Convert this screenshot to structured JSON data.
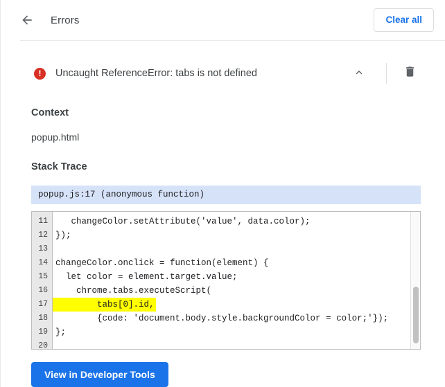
{
  "header": {
    "back_icon": "arrow-left-icon",
    "title": "Errors",
    "clear_all_label": "Clear all"
  },
  "error": {
    "icon": "error-circle-icon",
    "icon_glyph": "!",
    "title": "Uncaught ReferenceError: tabs is not defined",
    "collapse_icon": "chevron-up-icon",
    "delete_icon": "trash-icon"
  },
  "detail": {
    "context_label": "Context",
    "context_value": "popup.html",
    "stack_trace_label": "Stack Trace",
    "stack_entry": "popup.js:17 (anonymous function)"
  },
  "code": {
    "lines": [
      {
        "number": "11",
        "text": "   changeColor.setAttribute('value', data.color);",
        "highlight": false
      },
      {
        "number": "12",
        "text": "});",
        "highlight": false
      },
      {
        "number": "13",
        "text": "",
        "highlight": false
      },
      {
        "number": "14",
        "text": "changeColor.onclick = function(element) {",
        "highlight": false
      },
      {
        "number": "15",
        "text": "  let color = element.target.value;",
        "highlight": false
      },
      {
        "number": "16",
        "text": "    chrome.tabs.executeScript(",
        "highlight": false
      },
      {
        "number": "17",
        "text": "        tabs[0].id,",
        "highlight": true
      },
      {
        "number": "18",
        "text": "        {code: 'document.body.style.backgroundColor = color;'});",
        "highlight": false
      },
      {
        "number": "19",
        "text": "};",
        "highlight": false
      },
      {
        "number": "20",
        "text": "",
        "highlight": false
      }
    ]
  },
  "footer": {
    "devtools_label": "View in Developer Tools"
  },
  "colors": {
    "accent": "#1a73e8",
    "error": "#d93025",
    "highlight": "#ffff00",
    "stack_entry_bg": "#d6e2f7",
    "gutter_bg": "#e8e8e8"
  }
}
